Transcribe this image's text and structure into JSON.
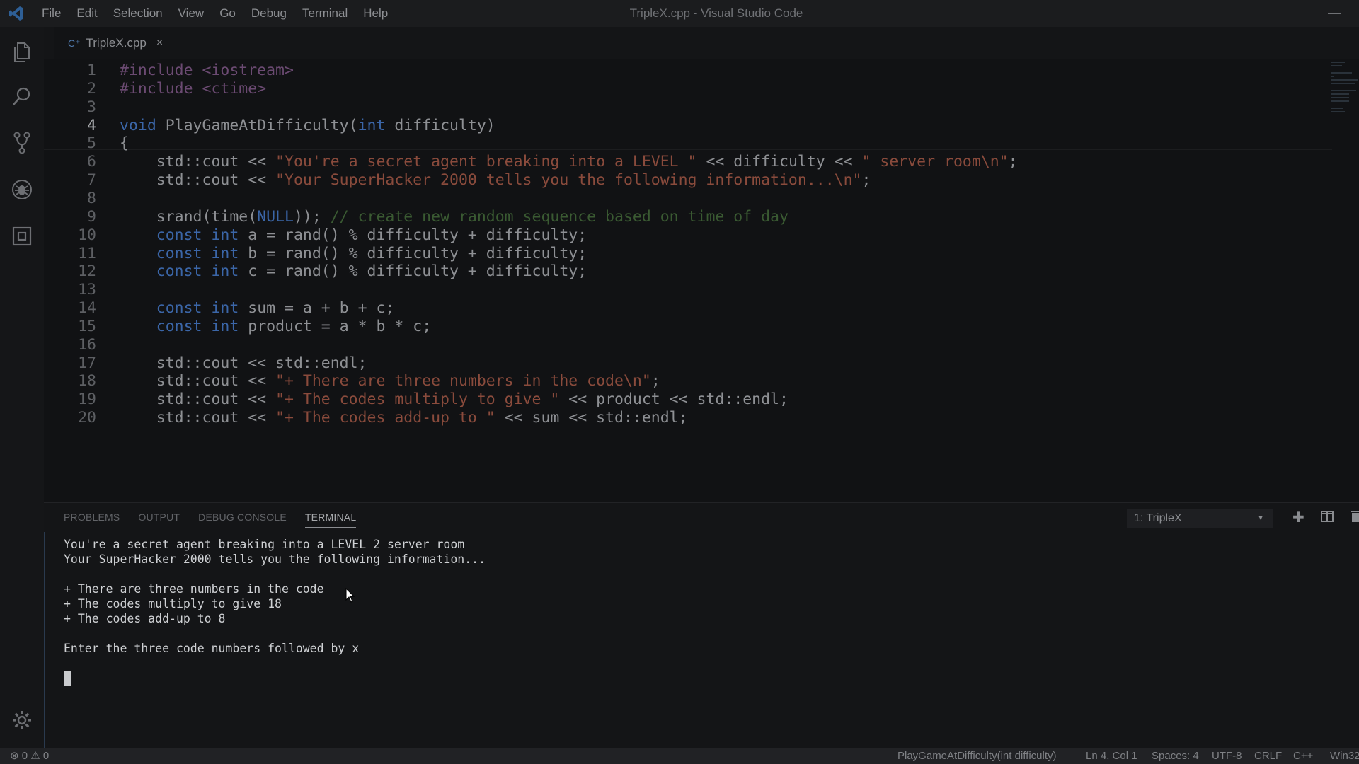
{
  "window": {
    "title": "TripleX.cpp - Visual Studio Code"
  },
  "menu": [
    "File",
    "Edit",
    "Selection",
    "View",
    "Go",
    "Debug",
    "Terminal",
    "Help"
  ],
  "tab": {
    "label": "TripleX.cpp",
    "close": "×"
  },
  "code": [
    {
      "n": "1",
      "t": "#include <iostream>"
    },
    {
      "n": "2",
      "t": "#include <ctime>"
    },
    {
      "n": "3",
      "t": ""
    },
    {
      "n": "4",
      "t": "void PlayGameAtDifficulty(int difficulty)"
    },
    {
      "n": "5",
      "t": "{"
    },
    {
      "n": "6",
      "t": "    std::cout << \"You're a secret agent breaking into a LEVEL \" << difficulty << \" server room\\n\";"
    },
    {
      "n": "7",
      "t": "    std::cout << \"Your SuperHacker 2000 tells you the following information...\\n\";"
    },
    {
      "n": "8",
      "t": ""
    },
    {
      "n": "9",
      "t": "    srand(time(NULL)); // create new random sequence based on time of day"
    },
    {
      "n": "10",
      "t": "    const int a = rand() % difficulty + difficulty;"
    },
    {
      "n": "11",
      "t": "    const int b = rand() % difficulty + difficulty;"
    },
    {
      "n": "12",
      "t": "    const int c = rand() % difficulty + difficulty;"
    },
    {
      "n": "13",
      "t": ""
    },
    {
      "n": "14",
      "t": "    const int sum = a + b + c;"
    },
    {
      "n": "15",
      "t": "    const int product = a * b * c;"
    },
    {
      "n": "16",
      "t": ""
    },
    {
      "n": "17",
      "t": "    std::cout << std::endl;"
    },
    {
      "n": "18",
      "t": "    std::cout << \"+ There are three numbers in the code\\n\";"
    },
    {
      "n": "19",
      "t": "    std::cout << \"+ The codes multiply to give \" << product << std::endl;"
    },
    {
      "n": "20",
      "t": "    std::cout << \"+ The codes add-up to \" << sum << std::endl;"
    }
  ],
  "panel": {
    "tabs": [
      "PROBLEMS",
      "OUTPUT",
      "DEBUG CONSOLE",
      "TERMINAL"
    ],
    "active_tab": "TERMINAL",
    "terminal_select": "1: TripleX",
    "terminal_lines": [
      "You're a secret agent breaking into a LEVEL 2 server room",
      "Your SuperHacker 2000 tells you the following information...",
      "",
      "+ There are three numbers in the code",
      "+ The codes multiply to give 18",
      "+ The codes add-up to 8",
      "",
      "Enter the three code numbers followed by x"
    ]
  },
  "status": {
    "errors": "0",
    "warnings": "0",
    "function": "PlayGameAtDifficulty(int difficulty)",
    "position": "Ln 4, Col 1",
    "spaces": "Spaces: 4",
    "encoding": "UTF-8",
    "eol": "CRLF",
    "language": "C++",
    "platform": "Win32"
  },
  "colors": {
    "background": "#111214",
    "keyword": "#3b66a8",
    "string": "#8a4b3c",
    "comment": "#3a5a32",
    "preprocessor": "#6b4a72",
    "identifier": "#8e9094"
  }
}
